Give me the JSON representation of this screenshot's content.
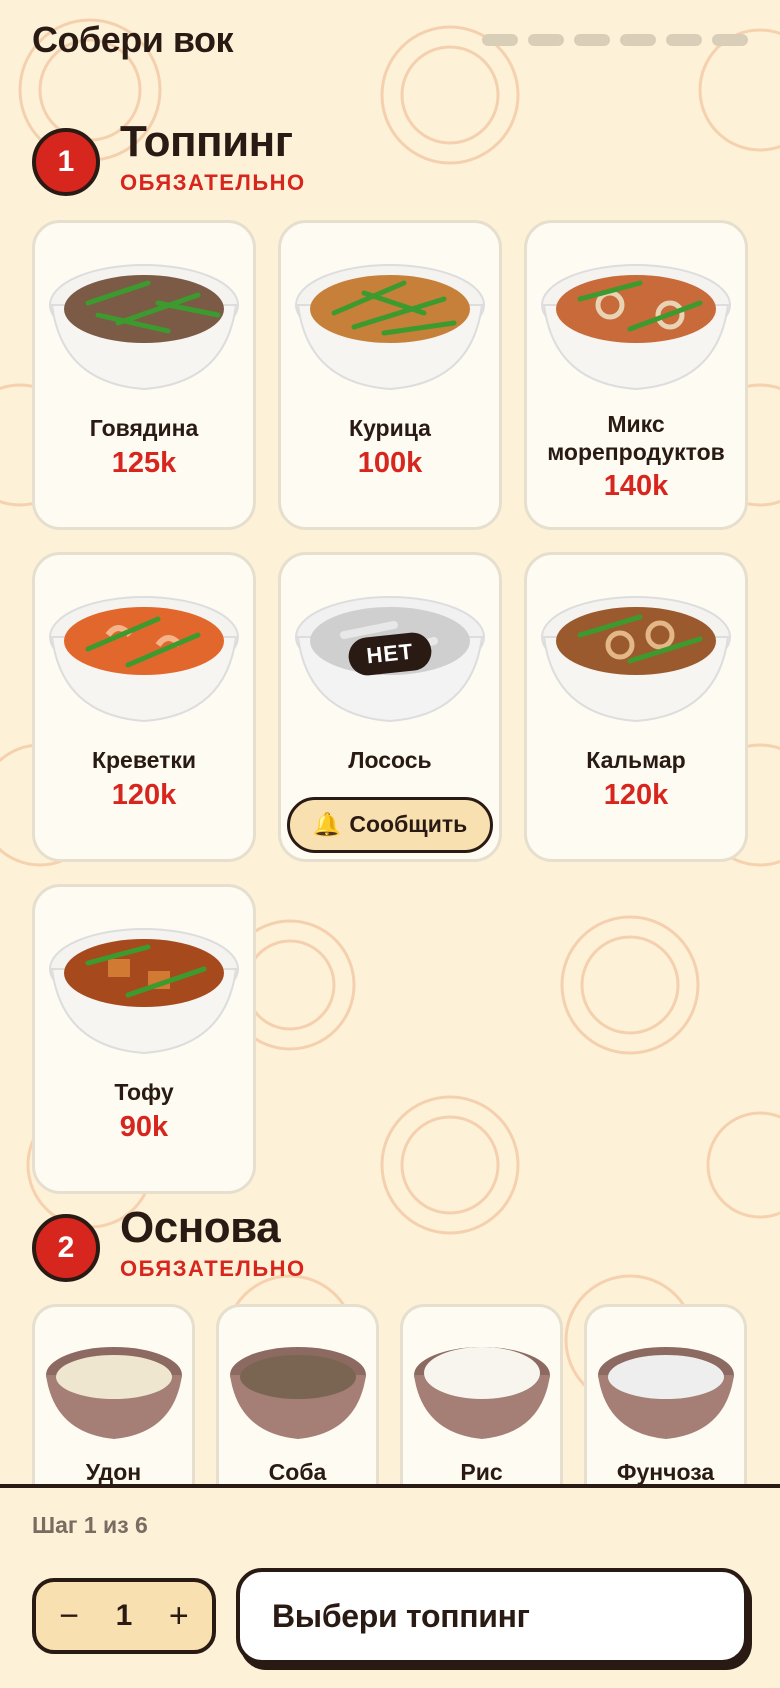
{
  "header": {
    "title": "Собери вок",
    "progress_steps": 6
  },
  "sections": [
    {
      "number": "1",
      "title": "Топпинг",
      "requirement": "ОБЯЗАТЕЛЬНО"
    },
    {
      "number": "2",
      "title": "Основа",
      "requirement": "ОБЯЗАТЕЛЬНО"
    }
  ],
  "toppings": [
    {
      "name": "Говядина",
      "price": "125k",
      "color": "#7b5a46"
    },
    {
      "name": "Курица",
      "price": "100k",
      "color": "#c7803a"
    },
    {
      "name": "Микс морепродуктов",
      "price": "140k",
      "color": "#c96a3a"
    },
    {
      "name": "Креветки",
      "price": "120k",
      "color": "#e2672d"
    },
    {
      "name": "Лосось",
      "out_of_stock_badge": "НЕТ",
      "notify_label": "Сообщить",
      "notify_icon": "bell-icon",
      "color": "#cfcfcf"
    },
    {
      "name": "Кальмар",
      "price": "120k",
      "color": "#9b5a2e"
    },
    {
      "name": "Тофу",
      "price": "90k",
      "color": "#a64a1e"
    }
  ],
  "bases": [
    {
      "name": "Удон",
      "color": "#efe6cf"
    },
    {
      "name": "Соба",
      "color": "#7a6552"
    },
    {
      "name": "Рис",
      "color": "#f7f5ee"
    },
    {
      "name": "Фунчоза",
      "color": "#eeeeee"
    }
  ],
  "footer": {
    "step_text": "Шаг 1 из 6",
    "quantity": "1",
    "minus": "−",
    "plus": "+",
    "cta_label": "Выбери топпинг"
  },
  "colors": {
    "accent": "#d7261e",
    "background": "#fdf1d8",
    "dark": "#2a1a14"
  }
}
